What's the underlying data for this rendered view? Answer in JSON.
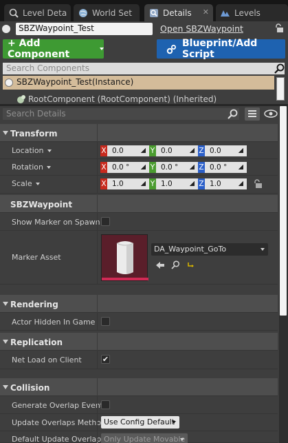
{
  "tabs": [
    {
      "label": "Level Deta",
      "icon": "search-icon",
      "active": false
    },
    {
      "label": "World Set",
      "icon": "globe-icon",
      "active": false
    },
    {
      "label": "Details",
      "icon": "magnifier-icon",
      "active": true,
      "close": "✕"
    },
    {
      "label": "Levels",
      "icon": "levels-icon",
      "active": false
    }
  ],
  "actor": {
    "name": "SBZWaypoint_Test",
    "open_link": "Open SBZWaypoint"
  },
  "buttons": {
    "add_component": "+ Add Component",
    "blueprint": "Blueprint/Add Script"
  },
  "components": {
    "search_placeholder": "Search Components",
    "items": [
      "SBZWaypoint_Test(Instance)",
      "RootComponent (RootComponent) (Inherited)"
    ]
  },
  "details": {
    "search_placeholder": "Search Details",
    "categories": {
      "transform": "Transform",
      "sbzwaypoint": "SBZWaypoint",
      "rendering": "Rendering",
      "replication": "Replication",
      "collision": "Collision"
    },
    "transform": {
      "location": {
        "label": "Location",
        "x": "0.0",
        "y": "0.0",
        "z": "0.0"
      },
      "rotation": {
        "label": "Rotation",
        "x": "0.0 °",
        "y": "0.0 °",
        "z": "0.0 °"
      },
      "scale": {
        "label": "Scale",
        "x": "1.0",
        "y": "1.0",
        "z": "1.0"
      }
    },
    "axes": {
      "x": "X",
      "y": "Y",
      "z": "Z"
    },
    "sbzwaypoint": {
      "show_marker_label": "Show Marker on Spawn",
      "show_marker_checked": false,
      "marker_asset_label": "Marker Asset",
      "marker_asset_value": "DA_Waypoint_GoTo"
    },
    "rendering": {
      "actor_hidden_label": "Actor Hidden In Game",
      "actor_hidden_checked": false
    },
    "replication": {
      "net_load_label": "Net Load on Client",
      "net_load_checked": true,
      "check_glyph": "✔"
    },
    "collision": {
      "gen_overlap_label": "Generate Overlap Events",
      "gen_overlap_checked": false,
      "update_overlaps_label": "Update Overlaps Method",
      "update_overlaps_value": "Use Config Default",
      "default_update_label": "Default Update Overlaps",
      "default_update_value": "Only Update Movable"
    }
  },
  "colors": {
    "accent_green": "#3e9a33",
    "accent_blue": "#1e62b0",
    "selection": "#d4bc9a"
  }
}
